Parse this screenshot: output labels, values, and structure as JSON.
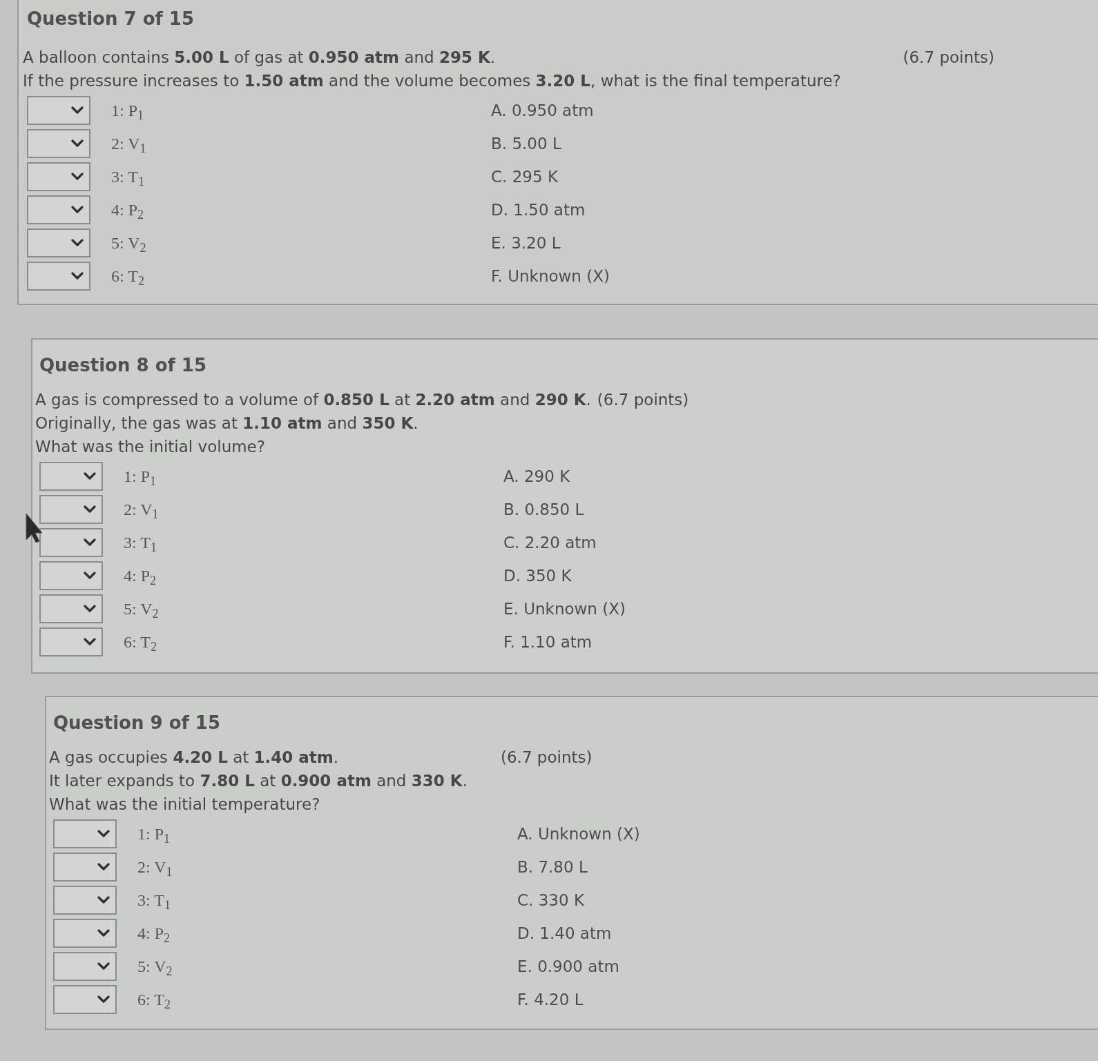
{
  "questions": [
    {
      "title": "Question 7 of 15",
      "points": "(6.7 points)",
      "prompt": [
        "A balloon contains **5.00 L** of gas at **0.950 atm** and **295 K**.",
        "If the pressure increases to **1.50 atm** and the volume becomes **3.20 L**, what is the final temperature?"
      ],
      "items": [
        "1: P$_{1}$",
        "2: V$_{1}$",
        "3: T$_{1}$",
        "4: P$_{2}$",
        "5: V$_{2}$",
        "6: T$_{2}$"
      ],
      "options": [
        "A. 0.950 atm",
        "B. 5.00 L",
        "C. 295 K",
        "D. 1.50 atm",
        "E. 3.20 L",
        "F. Unknown (X)"
      ]
    },
    {
      "title": "Question 8 of 15",
      "points": "(6.7 points)",
      "prompt": [
        "A gas is compressed to a volume of **0.850 L** at **2.20 atm** and **290 K**.",
        "Originally, the gas was at **1.10 atm** and **350 K**.",
        "What was the initial volume?"
      ],
      "items": [
        "1: P$_{1}$",
        "2: V$_{1}$",
        "3: T$_{1}$",
        "4: P$_{2}$",
        "5: V$_{2}$",
        "6: T$_{2}$"
      ],
      "options": [
        "A. 290 K",
        "B. 0.850 L",
        "C. 2.20 atm",
        "D. 350 K",
        "E. Unknown (X)",
        "F. 1.10 atm"
      ]
    },
    {
      "title": "Question 9 of 15",
      "points": "(6.7 points)",
      "prompt": [
        "A gas occupies **4.20 L** at **1.40 atm**.",
        "It later expands to **7.80 L** at **0.900 atm** and **330 K**.",
        "What was the initial temperature?"
      ],
      "items": [
        "1: P$_{1}$",
        "2: V$_{1}$",
        "3: T$_{1}$",
        "4: P$_{2}$",
        "5: V$_{2}$",
        "6: T$_{2}$"
      ],
      "options": [
        "A. Unknown (X)",
        "B. 7.80 L",
        "C. 330 K",
        "D. 1.40 atm",
        "E. 0.900 atm",
        "F. 4.20 L"
      ]
    }
  ]
}
